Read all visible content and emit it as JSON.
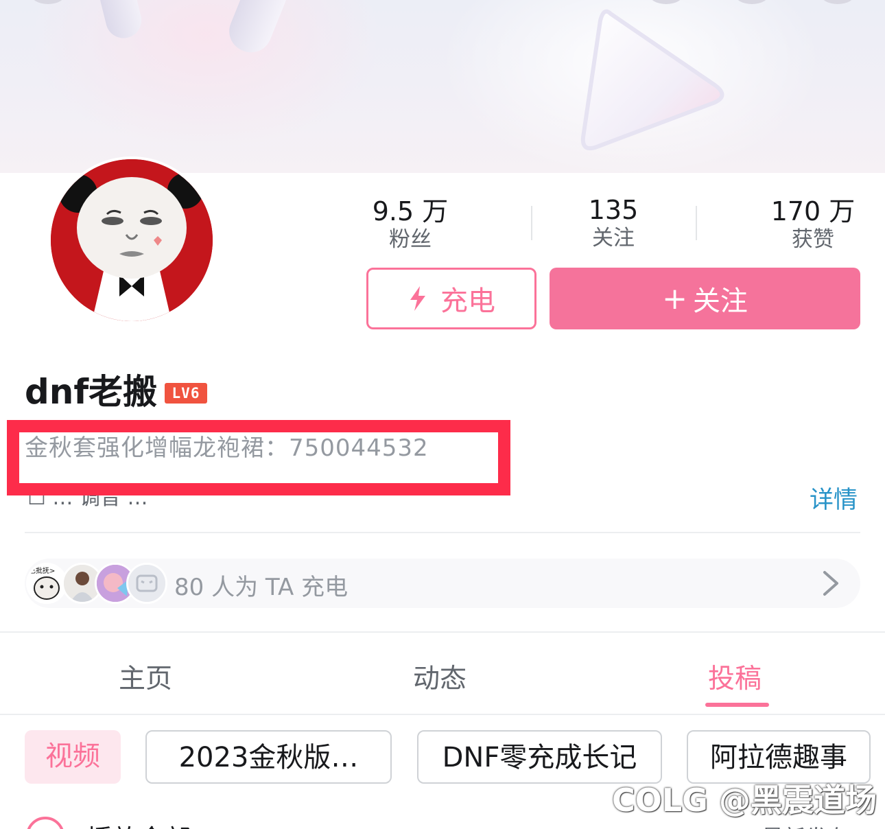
{
  "profile": {
    "username": "dnf老搬",
    "level": "LV6",
    "bio": "金秋套强化增幅龙袍裙：750044532",
    "bio_partial": "☐ … 调音 …",
    "details_link": "详情"
  },
  "stats": [
    {
      "value": "9.5 万",
      "label": "粉丝"
    },
    {
      "value": "135",
      "label": "关注"
    },
    {
      "value": "170 万",
      "label": "获赞"
    }
  ],
  "buttons": {
    "charge_label": "充电",
    "follow_plus": "+",
    "follow_label": "关注"
  },
  "charge_bar": {
    "text": "80 人为 TA 充电",
    "fan_badge_text": "已批抚>"
  },
  "tabs": [
    {
      "label": "主页",
      "active": false
    },
    {
      "label": "动态",
      "active": false
    },
    {
      "label": "投稿",
      "active": true
    }
  ],
  "chips": [
    {
      "label": "视频",
      "active": true
    },
    {
      "label": "2023金秋版…",
      "active": false
    },
    {
      "label": "DNF零充成长记",
      "active": false
    },
    {
      "label": "阿拉德趣事",
      "active": false
    }
  ],
  "bottom_row": {
    "play_all_label": "播放全部",
    "sort_label": "最新发布"
  },
  "watermark": "COLG @黑震道场",
  "colors": {
    "accent": "#fb7299",
    "follow_button": "#f5739b",
    "level_badge": "#f0533f",
    "highlight_box": "#fd2c4a",
    "link": "#2893c8"
  },
  "icons": [
    "bolt-icon",
    "plus-icon",
    "chevron-right-icon",
    "avatar-icon",
    "play-all-icon"
  ]
}
